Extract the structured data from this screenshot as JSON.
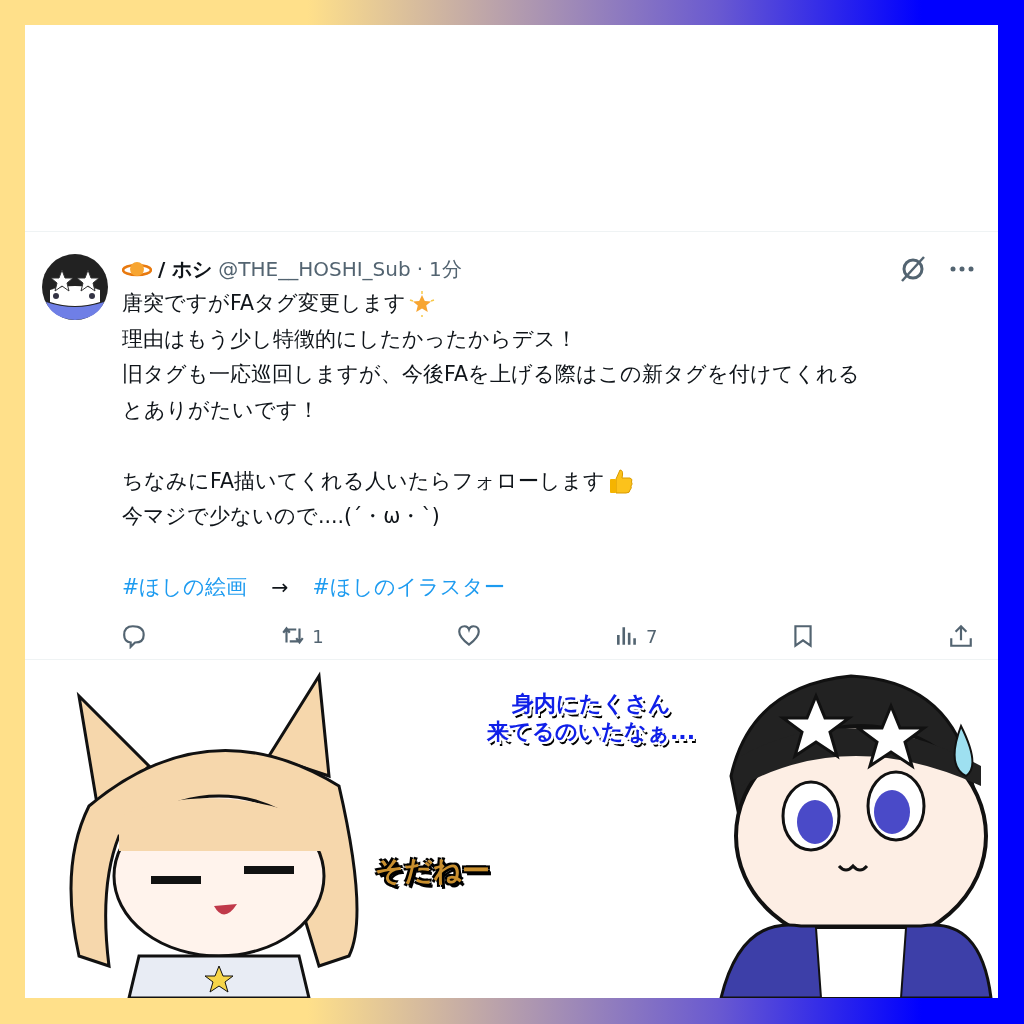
{
  "post": {
    "display_name": "/ ホシ",
    "handle": "@THE__HOSHI_Sub",
    "separator": "·",
    "time": "1分",
    "paragraphs": [
      [
        {
          "kind": "star",
          "text": "唐突ですがFAタグ変更します"
        },
        {
          "kind": "plain",
          "text": "理由はもう少し特徴的にしたかったからデス！"
        },
        {
          "kind": "plain",
          "text": "旧タグも一応巡回しますが、今後FAを上げる際はこの新タグを付けてくれる"
        },
        {
          "kind": "plain",
          "text": "とありがたいです！"
        }
      ],
      [
        {
          "kind": "thumbs",
          "text": "ちなみにFA描いてくれる人いたらフォローします"
        },
        {
          "kind": "plain",
          "text": "今マジで少ないので....(´・ω・`)"
        }
      ]
    ],
    "tags": [
      {
        "kind": "hashtag",
        "text": "#ほしの絵画"
      },
      {
        "kind": "arrow",
        "text": "→"
      },
      {
        "kind": "hashtag",
        "text": "#ほしのイラスター"
      }
    ],
    "actions": [
      {
        "kind": "reply"
      },
      {
        "kind": "repost",
        "count": "1"
      },
      {
        "kind": "like"
      },
      {
        "kind": "views",
        "count": "7"
      },
      {
        "kind": "bookmark"
      },
      {
        "kind": "share"
      }
    ]
  },
  "illustration": {
    "captions": [
      {
        "kind": "blue",
        "lines": [
          "身内にたくさん",
          "来てるのいたなぁ..."
        ]
      },
      {
        "kind": "cream",
        "lines": [
          "そだねー"
        ]
      }
    ]
  }
}
